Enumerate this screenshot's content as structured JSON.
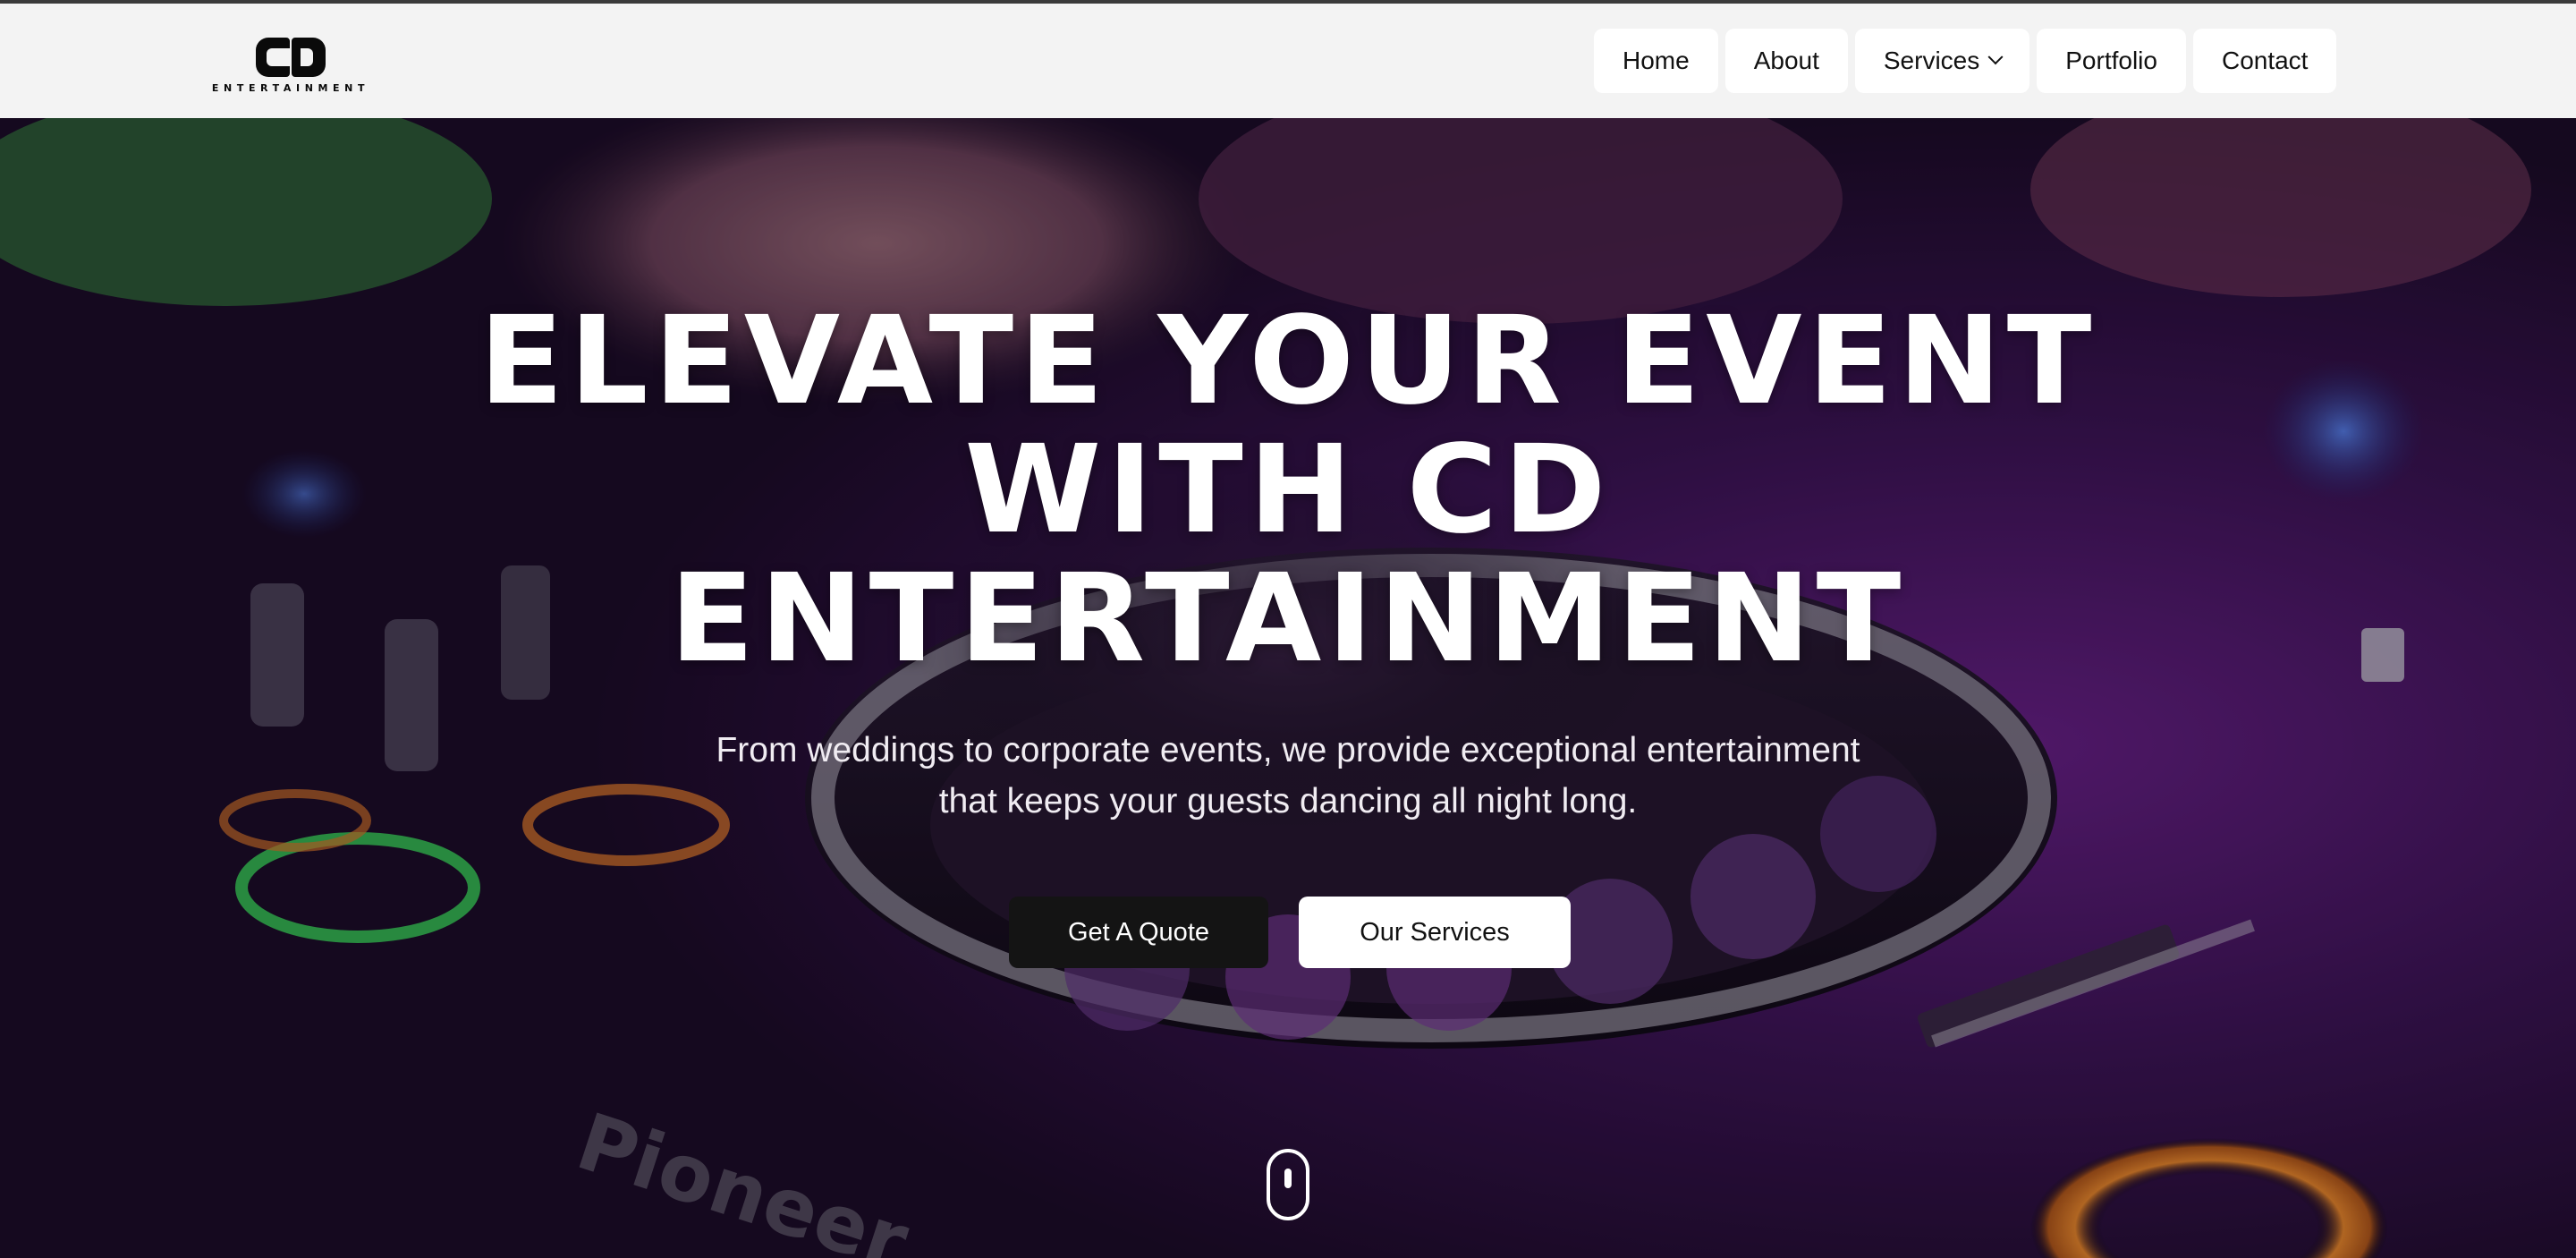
{
  "brand": {
    "logo_mark": "CD",
    "logo_subtitle": "ENTERTAINMENT"
  },
  "nav": {
    "items": [
      {
        "label": "Home"
      },
      {
        "label": "About"
      },
      {
        "label": "Services",
        "has_dropdown": true,
        "icon": "chevron-down-icon"
      },
      {
        "label": "Portfolio"
      },
      {
        "label": "Contact"
      }
    ]
  },
  "hero": {
    "title_line1": "ELEVATE YOUR EVENT",
    "title_line2": "WITH CD",
    "title_line3": "ENTERTAINMENT",
    "subtitle_line1": "From weddings to corporate events, we provide exceptional entertainment",
    "subtitle_line2": "that keeps your guests dancing all night long.",
    "primary_cta": "Get A Quote",
    "secondary_cta": "Our Services",
    "scroll_icon": "mouse-scroll-icon",
    "background_image": "DJ controller with purple lighting"
  },
  "colors": {
    "nav_bg": "#f3f3f3",
    "primary_button": "#141414",
    "secondary_button": "#ffffff",
    "hero_tint": "#5a1e78"
  }
}
